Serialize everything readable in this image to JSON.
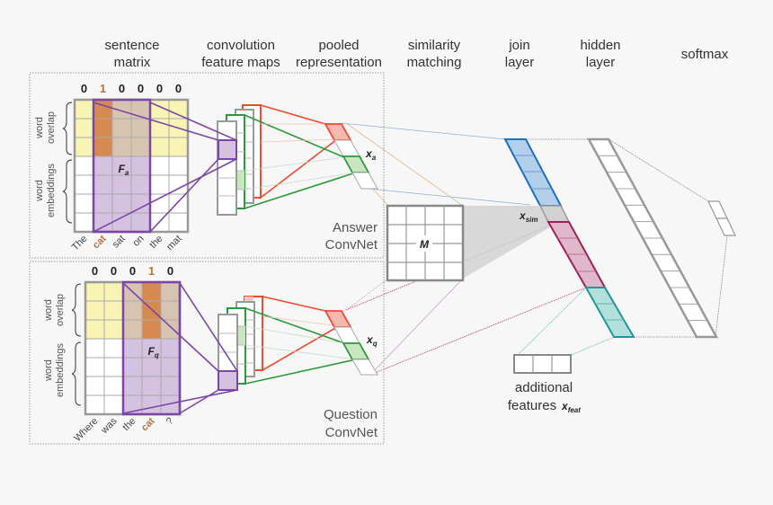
{
  "headers": {
    "sentence_matrix": [
      "sentence",
      "matrix"
    ],
    "conv_maps": [
      "convolution",
      "feature maps"
    ],
    "pooled": [
      "pooled",
      "representation"
    ],
    "similarity": [
      "similarity",
      "matching"
    ],
    "join": [
      "join",
      "layer"
    ],
    "hidden": [
      "hidden",
      "layer"
    ],
    "softmax": [
      "softmax"
    ]
  },
  "answer": {
    "overlap_flags": [
      "0",
      "1",
      "0",
      "0",
      "0",
      "0"
    ],
    "words": [
      "The",
      "cat",
      "sat",
      "on",
      "the",
      "mat"
    ],
    "highlight_index": 1,
    "filter_label": "F",
    "filter_sub": "a",
    "pooled_label": "x",
    "pooled_sub": "a",
    "net_label": [
      "Answer",
      "ConvNet"
    ]
  },
  "question": {
    "overlap_flags": [
      "0",
      "0",
      "0",
      "1",
      "0"
    ],
    "words": [
      "Where",
      "was",
      "the",
      "cat",
      "?"
    ],
    "highlight_index": 3,
    "filter_label": "F",
    "filter_sub": "q",
    "pooled_label": "x",
    "pooled_sub": "q",
    "net_label": [
      "Question",
      "ConvNet"
    ]
  },
  "side_labels": {
    "overlap": [
      "word",
      "overlap"
    ],
    "embeddings": [
      "word",
      "embeddings"
    ]
  },
  "similarity_matrix": {
    "label": "M"
  },
  "join_layer": {
    "sim_label": "x",
    "sim_sub": "sim"
  },
  "additional_features": {
    "line1": "additional",
    "line2": "features",
    "sym": "x",
    "sub": "feat"
  },
  "colors": {
    "purple": "#7d45a8",
    "purple_fill": "#d4c2e0",
    "yellow_fill": "#f8f4b4",
    "tan_fill": "#d6c4b0",
    "orange_fill": "#d68a50",
    "red": "#ef4a2e",
    "red_fill": "#f7b8ad",
    "green": "#2a9a3a",
    "green_fill": "#c8e6c0",
    "blue": "#1d6fc4",
    "blue_fill": "#b3cfea",
    "magenta": "#a0205a",
    "magenta_fill": "#dfb8cc",
    "teal": "#1a9a98",
    "teal_fill": "#b3e0dc",
    "grey": "#8a8a8a"
  }
}
